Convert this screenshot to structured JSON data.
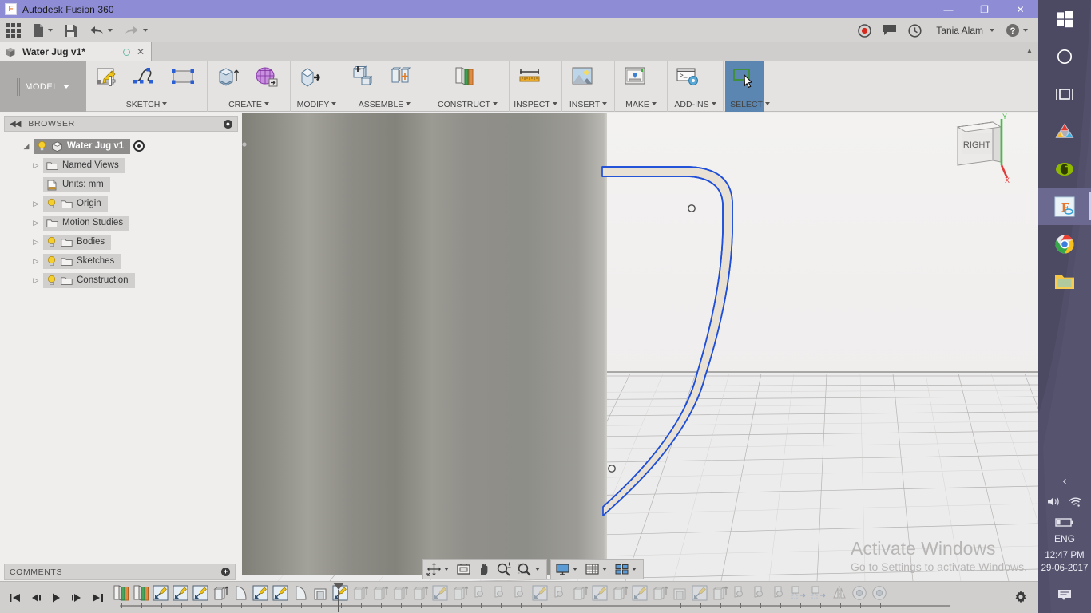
{
  "window": {
    "app_title": "Autodesk Fusion 360",
    "logo_letter": "F",
    "minimize": "—",
    "restore": "❐",
    "close": "✕"
  },
  "quick_access": {
    "items": [
      {
        "name": "app-grid-button",
        "label": ""
      },
      {
        "name": "new-file-button",
        "label": ""
      },
      {
        "name": "save-button",
        "label": ""
      },
      {
        "name": "undo-button",
        "label": ""
      },
      {
        "name": "redo-button",
        "label": ""
      }
    ],
    "right_items": [
      {
        "name": "record-button",
        "label": ""
      },
      {
        "name": "comment-button",
        "label": ""
      },
      {
        "name": "job-status-button",
        "label": ""
      }
    ],
    "user_name": "Tania Alam",
    "help_label": "?"
  },
  "document_tab": {
    "title": "Water Jug v1*",
    "close_label": "✕"
  },
  "workspace": {
    "label": "MODEL"
  },
  "ribbon": {
    "groups": [
      {
        "label": "SKETCH",
        "commands": [
          {
            "name": "create-sketch-command",
            "icon": "sketch-create-icon"
          },
          {
            "name": "spline-command",
            "icon": "spline-icon"
          },
          {
            "name": "rectangle-command",
            "icon": "rectangle-icon"
          }
        ]
      },
      {
        "label": "CREATE",
        "commands": [
          {
            "name": "extrude-command",
            "icon": "extrude-icon"
          },
          {
            "name": "create-form-command",
            "icon": "form-mesh-icon"
          }
        ]
      },
      {
        "label": "MODIFY",
        "commands": [
          {
            "name": "press-pull-command",
            "icon": "press-pull-icon"
          }
        ]
      },
      {
        "label": "ASSEMBLE",
        "commands": [
          {
            "name": "new-component-command",
            "icon": "new-component-icon"
          },
          {
            "name": "joint-command",
            "icon": "joint-icon"
          }
        ]
      },
      {
        "label": "CONSTRUCT",
        "commands": [
          {
            "name": "offset-plane-command",
            "icon": "offset-plane-icon"
          }
        ]
      },
      {
        "label": "INSPECT",
        "commands": [
          {
            "name": "measure-command",
            "icon": "measure-ruler-icon"
          }
        ]
      },
      {
        "label": "INSERT",
        "commands": [
          {
            "name": "insert-canvas-command",
            "icon": "insert-image-icon"
          }
        ]
      },
      {
        "label": "MAKE",
        "commands": [
          {
            "name": "3d-print-command",
            "icon": "printer-3d-icon"
          }
        ]
      },
      {
        "label": "ADD-INS",
        "commands": [
          {
            "name": "scripts-addins-command",
            "icon": "scripts-addins-icon"
          }
        ]
      },
      {
        "label": "SELECT",
        "commands": [
          {
            "name": "select-command",
            "icon": "select-cursor-icon"
          }
        ]
      }
    ]
  },
  "browser": {
    "panel_title": "BROWSER",
    "collapse_label": "◀◀",
    "root": {
      "label": "Water Jug v1",
      "name": "browser-root-water-jug"
    },
    "items": [
      {
        "label": "Named Views",
        "name": "browser-item-named-views",
        "arrow": true,
        "bulb": false,
        "icon": "folder-icon"
      },
      {
        "label": "Units: mm",
        "name": "browser-item-units",
        "arrow": false,
        "bulb": false,
        "icon": "units-document-icon"
      },
      {
        "label": "Origin",
        "name": "browser-item-origin",
        "arrow": true,
        "bulb": true,
        "icon": "folder-icon"
      },
      {
        "label": "Motion Studies",
        "name": "browser-item-motion-studies",
        "arrow": true,
        "bulb": false,
        "icon": "folder-icon"
      },
      {
        "label": "Bodies",
        "name": "browser-item-bodies",
        "arrow": true,
        "bulb": true,
        "icon": "folder-icon"
      },
      {
        "label": "Sketches",
        "name": "browser-item-sketches",
        "arrow": true,
        "bulb": true,
        "icon": "folder-icon"
      },
      {
        "label": "Construction",
        "name": "browser-item-construction",
        "arrow": true,
        "bulb": true,
        "icon": "folder-icon"
      }
    ]
  },
  "comments": {
    "title": "COMMENTS",
    "add_label": "+"
  },
  "canvas": {
    "view_cube_label": "RIGHT",
    "axis_y_label": "Y",
    "axis_x_label": "X",
    "watermark_line1": "Activate Windows",
    "watermark_line2": "Go to Settings to activate Windows.",
    "nav_buttons": [
      {
        "name": "orbit-button",
        "icon": "orbit-icon",
        "caret": true
      },
      {
        "name": "look-at-button",
        "icon": "look-at-icon",
        "caret": false
      },
      {
        "name": "pan-button",
        "icon": "pan-hand-icon",
        "caret": false
      },
      {
        "name": "zoom-button",
        "icon": "zoom-magnifier-icon",
        "caret": false
      },
      {
        "name": "fit-button",
        "icon": "fit-window-icon",
        "caret": true
      }
    ],
    "display_buttons": [
      {
        "name": "display-settings-button",
        "icon": "monitor-icon",
        "caret": true
      },
      {
        "name": "grid-snaps-button",
        "icon": "grid-icon",
        "caret": true
      },
      {
        "name": "viewports-button",
        "icon": "viewports-icon",
        "caret": true
      }
    ]
  },
  "timeline": {
    "playback": [
      {
        "name": "timeline-go-to-beginning",
        "icon": "skip-start-icon"
      },
      {
        "name": "timeline-step-back",
        "icon": "step-back-icon"
      },
      {
        "name": "timeline-play",
        "icon": "play-icon"
      },
      {
        "name": "timeline-step-forward",
        "icon": "step-forward-icon"
      },
      {
        "name": "timeline-go-to-end",
        "icon": "skip-end-icon"
      }
    ],
    "settings_label": "",
    "features": [
      {
        "icon": "construct-plane-icon",
        "dim": false
      },
      {
        "icon": "construct-plane-icon",
        "dim": false
      },
      {
        "icon": "sketch-icon",
        "dim": false
      },
      {
        "icon": "sketch-icon",
        "dim": false
      },
      {
        "icon": "sketch-icon",
        "dim": false
      },
      {
        "icon": "extrude-icon",
        "dim": false
      },
      {
        "icon": "revolve-icon",
        "dim": false
      },
      {
        "icon": "sketch-icon",
        "dim": false
      },
      {
        "icon": "sketch-icon",
        "dim": false
      },
      {
        "icon": "revolve-icon",
        "dim": false
      },
      {
        "icon": "shell-icon",
        "dim": false
      },
      {
        "icon": "sketch-icon",
        "dim": false
      },
      {
        "icon": "extrude-icon",
        "dim": true
      },
      {
        "icon": "extrude-icon",
        "dim": true
      },
      {
        "icon": "extrude-icon",
        "dim": true
      },
      {
        "icon": "extrude-icon",
        "dim": true
      },
      {
        "icon": "sketch-icon",
        "dim": true
      },
      {
        "icon": "extrude-icon",
        "dim": true
      },
      {
        "icon": "fillet-icon",
        "dim": true
      },
      {
        "icon": "fillet-icon",
        "dim": true
      },
      {
        "icon": "fillet-icon",
        "dim": true
      },
      {
        "icon": "sketch-icon",
        "dim": true
      },
      {
        "icon": "fillet-icon",
        "dim": true
      },
      {
        "icon": "extrude-icon",
        "dim": true
      },
      {
        "icon": "sketch-icon",
        "dim": true
      },
      {
        "icon": "extrude-icon",
        "dim": true
      },
      {
        "icon": "sketch-icon",
        "dim": true
      },
      {
        "icon": "extrude-icon",
        "dim": true
      },
      {
        "icon": "shell-icon",
        "dim": true
      },
      {
        "icon": "sketch-icon",
        "dim": true
      },
      {
        "icon": "extrude-icon",
        "dim": true
      },
      {
        "icon": "fillet-icon",
        "dim": true
      },
      {
        "icon": "fillet-icon",
        "dim": true
      },
      {
        "icon": "fillet-icon",
        "dim": true
      },
      {
        "icon": "pattern-icon",
        "dim": true
      },
      {
        "icon": "pattern-icon",
        "dim": true
      },
      {
        "icon": "mirror-icon",
        "dim": true
      },
      {
        "icon": "appearance-icon",
        "dim": true
      },
      {
        "icon": "appearance-icon",
        "dim": true
      }
    ]
  },
  "taskbar": {
    "items": [
      {
        "name": "start-button",
        "icon": "windows-logo-icon",
        "active": false
      },
      {
        "name": "cortana-button",
        "icon": "cortana-circle-icon",
        "active": false
      },
      {
        "name": "task-view-button",
        "icon": "task-view-icon",
        "active": false
      },
      {
        "name": "autodesk-app-button",
        "icon": "autodesk-triangle-icon",
        "active": false
      },
      {
        "name": "groupon-app-button",
        "icon": "green-g-icon",
        "active": false
      },
      {
        "name": "fusion360-taskbar-button",
        "icon": "fusion-360-icon",
        "active": true
      },
      {
        "name": "chrome-taskbar-button",
        "icon": "chrome-icon",
        "active": false
      },
      {
        "name": "file-explorer-button",
        "icon": "folder-explorer-icon",
        "active": false
      }
    ],
    "tray": {
      "expand_label": "‹",
      "language": "ENG",
      "time": "12:47 PM",
      "date": "29-06-2017"
    }
  },
  "colors": {
    "titlebar": "#8d8cd4",
    "ribbon_bg": "#e4e3e2",
    "selected_command": "#5b86b2",
    "sketch_line": "#1f4fd8",
    "sketch_fill": "#e8e0d2",
    "taskbar": "#4c4a63"
  }
}
